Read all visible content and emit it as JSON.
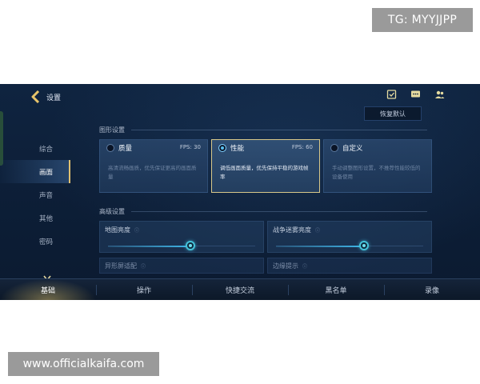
{
  "watermarks": {
    "tg": "TG: MYYJJPP",
    "site": "www.officialkaifa.com"
  },
  "header": {
    "title": "设置",
    "icons": [
      "task-icon",
      "chat-icon",
      "friends-icon"
    ]
  },
  "reset_button": "恢复默认",
  "sidebar": {
    "items": [
      {
        "label": "综合",
        "active": false
      },
      {
        "label": "画面",
        "active": true
      },
      {
        "label": "声音",
        "active": false
      },
      {
        "label": "其他",
        "active": false
      },
      {
        "label": "密码",
        "active": false
      }
    ]
  },
  "graphics": {
    "heading": "图形设置",
    "cards": [
      {
        "title": "质量",
        "fps": "FPS: 30",
        "desc": "高清流畅画质，优先保证更高的画面质量",
        "selected": false
      },
      {
        "title": "性能",
        "fps": "FPS: 60",
        "desc": "调低画面质量，优先保持平稳的游戏帧率",
        "selected": true
      },
      {
        "title": "自定义",
        "fps": "",
        "desc": "手动调整图形设置，不推荐性能较低的设备使用",
        "selected": false
      }
    ]
  },
  "advanced": {
    "heading": "高级设置",
    "sliders": [
      {
        "label": "地图亮度",
        "value": 0.56
      },
      {
        "label": "战争迷雾亮度",
        "value": 0.6
      }
    ],
    "partial": [
      "异形屏适配",
      "边缘提示"
    ]
  },
  "tabs": [
    {
      "label": "基础",
      "active": true
    },
    {
      "label": "操作",
      "active": false
    },
    {
      "label": "快捷交流",
      "active": false
    },
    {
      "label": "黑名单",
      "active": false
    },
    {
      "label": "录像",
      "active": false
    }
  ],
  "colors": {
    "accent_gold": "#d8c88a",
    "slider_cyan": "#3fb6e8",
    "bg_navy": "#0f2440"
  }
}
